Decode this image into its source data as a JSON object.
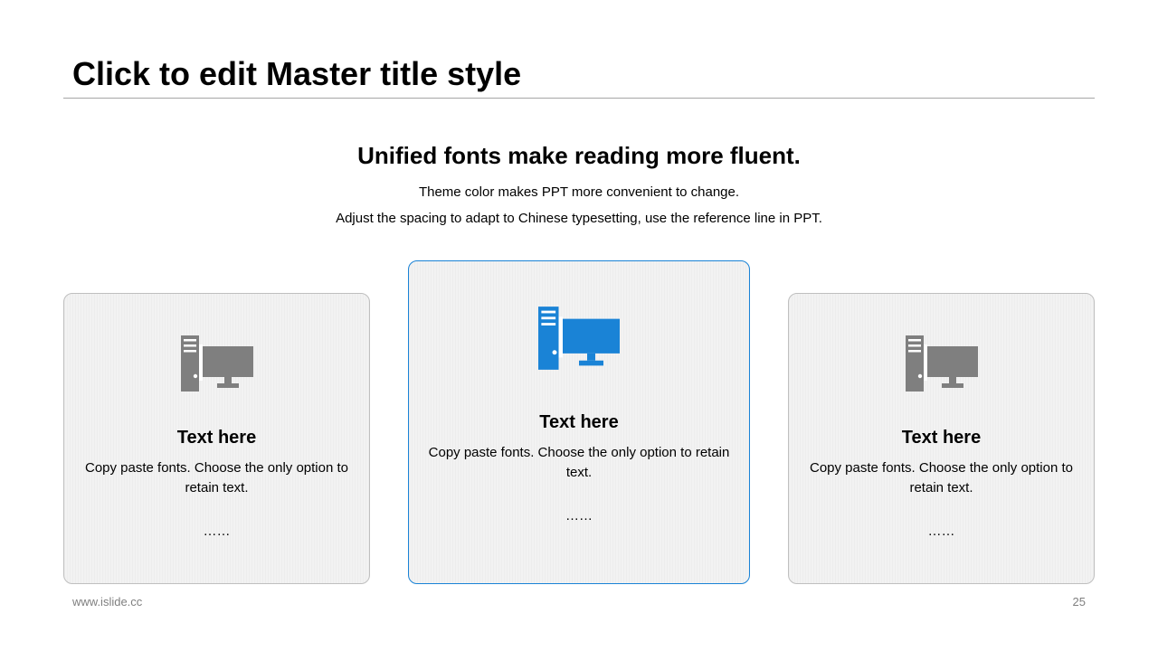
{
  "slide": {
    "title": "Click to edit Master title style",
    "headline": "Unified fonts make reading more fluent.",
    "subline_1": "Theme color makes PPT more convenient to change.",
    "subline_2": "Adjust the spacing to adapt to Chinese typesetting, use the reference line in PPT."
  },
  "cards": [
    {
      "icon": "desktop-computer-icon",
      "icon_color": "#7f7f7f",
      "title": "Text here",
      "body": "Copy paste fonts. Choose the only option to retain text.",
      "ellipsis": "……"
    },
    {
      "icon": "desktop-computer-icon",
      "icon_color": "#1a83d6",
      "title": "Text here",
      "body": "Copy paste fonts. Choose the only option to retain text.",
      "ellipsis": "……",
      "highlighted": true
    },
    {
      "icon": "desktop-computer-icon",
      "icon_color": "#7f7f7f",
      "title": "Text here",
      "body": "Copy paste fonts. Choose the only option to retain text.",
      "ellipsis": "……"
    }
  ],
  "footer": {
    "website": "www.islide.cc",
    "page_number": "25"
  },
  "colors": {
    "accent": "#1a83d6",
    "card_border": "#bfbfbf",
    "card_background": "#f2f2f2",
    "icon_gray": "#7f7f7f",
    "footer_text": "#7f7f7f"
  }
}
